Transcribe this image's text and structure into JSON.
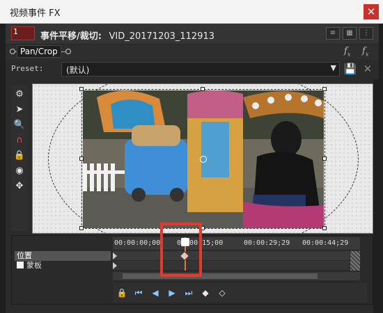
{
  "window": {
    "title": "视频事件 FX",
    "close_symbol": "✕"
  },
  "fx_header": {
    "thumb_number": "1",
    "title": "事件平移/裁切:",
    "filename": "VID_20171203_112913"
  },
  "pan_crop": {
    "label": "Pan/Crop"
  },
  "preset": {
    "label": "Preset:",
    "value": "(默认)"
  },
  "timeline": {
    "ticks": [
      "00:00:00;00",
      "00:00:15;00",
      "00:00:29;29",
      "00:00:44;29"
    ],
    "tracks": [
      {
        "label": "位置",
        "selected": true
      },
      {
        "label": "蒙板",
        "selected": false
      }
    ]
  },
  "icons": {
    "close": "close-icon",
    "save": "save-icon",
    "delete": "delete-icon",
    "gear": "gear-icon",
    "pointer": "pointer-icon",
    "zoom": "zoom-icon",
    "magnet": "magnet-icon",
    "lock": "lock-icon",
    "record": "record-icon",
    "move": "move-icon"
  },
  "colors": {
    "annotation": "#e53a2a",
    "keyframe_button": "#8cc6ff",
    "playhead": "#e07a3a"
  }
}
